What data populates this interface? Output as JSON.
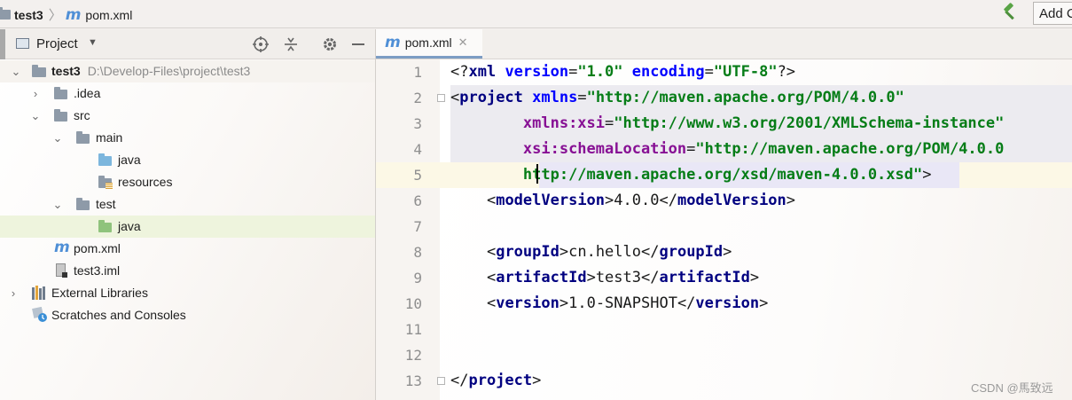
{
  "navbar": {
    "project": "test3",
    "file": "pom.xml",
    "add_config_label": "Add C"
  },
  "project_panel": {
    "title": "Project",
    "tree": [
      {
        "label": "test3",
        "path": "D:\\Develop-Files\\project\\test3",
        "icon": "module-folder-icon"
      },
      {
        "label": ".idea",
        "icon": "folder-icon"
      },
      {
        "label": "src",
        "icon": "folder-icon"
      },
      {
        "label": "main",
        "icon": "folder-icon"
      },
      {
        "label": "java",
        "icon": "source-folder-icon"
      },
      {
        "label": "resources",
        "icon": "resources-folder-icon"
      },
      {
        "label": "test",
        "icon": "folder-icon"
      },
      {
        "label": "java",
        "icon": "test-source-folder-icon"
      },
      {
        "label": "pom.xml",
        "icon": "maven-icon"
      },
      {
        "label": "test3.iml",
        "icon": "iml-file-icon"
      },
      {
        "label": "External Libraries",
        "icon": "libraries-icon"
      },
      {
        "label": "Scratches and Consoles",
        "icon": "scratches-icon"
      }
    ]
  },
  "editor": {
    "tab_label": "pom.xml",
    "current_line": 5,
    "line_numbers": [
      "1",
      "2",
      "3",
      "4",
      "5",
      "6",
      "7",
      "8",
      "9",
      "10",
      "11",
      "12",
      "13"
    ]
  },
  "colors": {
    "accent": "#4f8fd6",
    "selection": "#eef4dd",
    "tag": "#000080",
    "string": "#067d17",
    "attribute": "#0000ff",
    "namespace": "#871094"
  },
  "watermark": "CSDN @馬致远"
}
